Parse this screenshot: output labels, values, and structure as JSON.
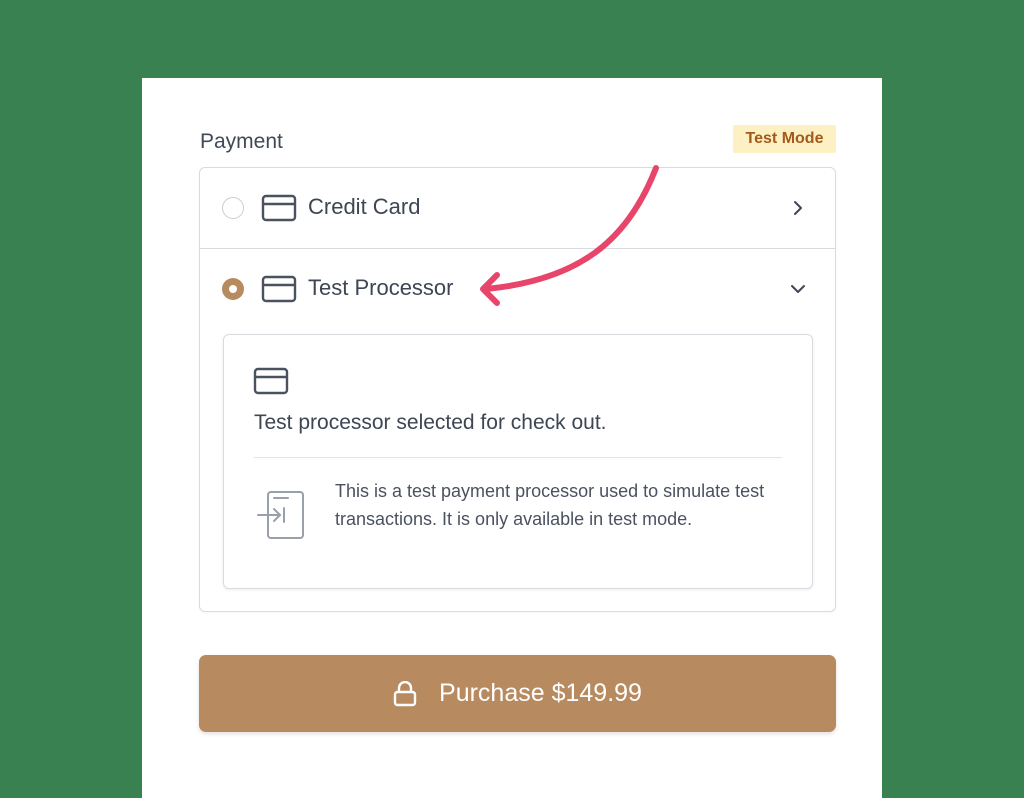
{
  "payment": {
    "label": "Payment",
    "badge": "Test Mode"
  },
  "methods": [
    {
      "label": "Credit Card",
      "selected": false,
      "expanded": false,
      "icon": "credit-card-icon"
    },
    {
      "label": "Test Processor",
      "selected": true,
      "expanded": true,
      "icon": "credit-card-icon"
    }
  ],
  "details": {
    "heading": "Test processor selected for check out.",
    "description": "This is a test payment processor used to simulate test transactions. It is only available in test mode.",
    "icon": "login-arrow-icon"
  },
  "purchase": {
    "label": "Purchase $149.99",
    "icon": "lock-icon"
  },
  "colors": {
    "background": "#3a8152",
    "accent": "#b78a5f",
    "badge_bg": "#fdf1c4",
    "badge_text": "#a35a1c",
    "annotation_arrow": "#e8456b"
  }
}
